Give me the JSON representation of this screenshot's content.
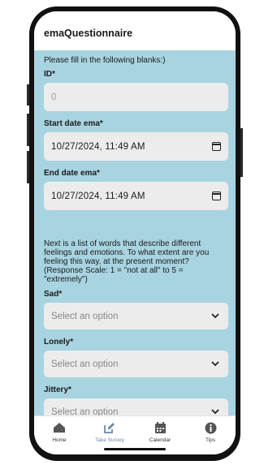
{
  "app": {
    "title": "emaQuestionnaire"
  },
  "form": {
    "intro": "Please fill in the following blanks:)",
    "id": {
      "label": "ID*",
      "placeholder": "0"
    },
    "start_date": {
      "label": "Start date ema*",
      "value": "10/27/2024, 11:49 AM"
    },
    "end_date": {
      "label": "End date ema*",
      "value": "10/27/2024, 11:49 AM"
    },
    "instructions": [
      "Next is a list of words that describe different",
      "feelings and emotions. To what extent are you",
      "feeling this way, at the present moment?",
      "(Response Scale: 1 = \"not at all\" to 5 =",
      "\"extremely\")"
    ],
    "questions": [
      {
        "label": "Sad*",
        "placeholder": "Select an option"
      },
      {
        "label": "Lonely*",
        "placeholder": "Select an option"
      },
      {
        "label": "Jittery*",
        "placeholder": "Select an option"
      }
    ]
  },
  "tabs": [
    {
      "label": "Home",
      "icon": "home-icon",
      "active": false
    },
    {
      "label": "Take Survey",
      "icon": "edit-icon",
      "active": true
    },
    {
      "label": "Calendar",
      "icon": "calendar-icon",
      "active": false
    },
    {
      "label": "Tips",
      "icon": "info-icon",
      "active": false
    }
  ],
  "colors": {
    "content_bg": "#a8d4e1",
    "input_bg": "#ececec",
    "active_tab": "#6b8aa8"
  }
}
